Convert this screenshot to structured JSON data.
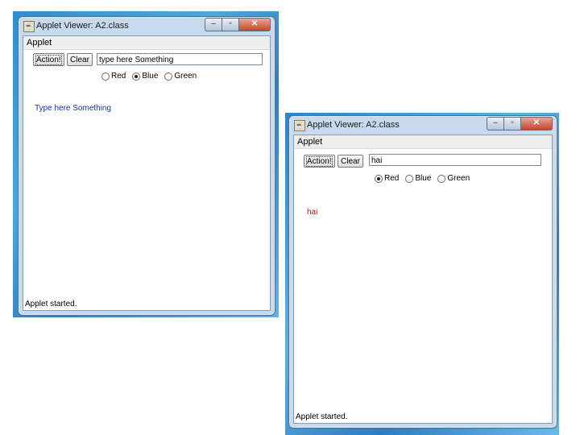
{
  "colors": {
    "blue_text": "#1a2e9e",
    "red_text": "#b01818",
    "desktop_blue": "#2e8fd0"
  },
  "windows": [
    {
      "title": "Applet Viewer: A2.class",
      "menu": "Applet",
      "action_button": "Action!",
      "clear_button": "Clear",
      "input_value": "type here Something",
      "radio_labels": [
        "Red",
        "Blue",
        "Green"
      ],
      "selected_radio": "Blue",
      "output_text": "Type here Something",
      "output_color": "blue",
      "status": "Applet started.",
      "window_controls": [
        "minimize-icon",
        "maximize-icon",
        "close-icon"
      ]
    },
    {
      "title": "Applet Viewer: A2.class",
      "menu": "Applet",
      "action_button": "Action!",
      "clear_button": "Clear",
      "input_value": "hai",
      "radio_labels": [
        "Red",
        "Blue",
        "Green"
      ],
      "selected_radio": "Red",
      "output_text": "hai",
      "output_color": "red",
      "status": "Applet started.",
      "window_controls": [
        "minimize-icon",
        "maximize-icon",
        "close-icon"
      ]
    }
  ]
}
